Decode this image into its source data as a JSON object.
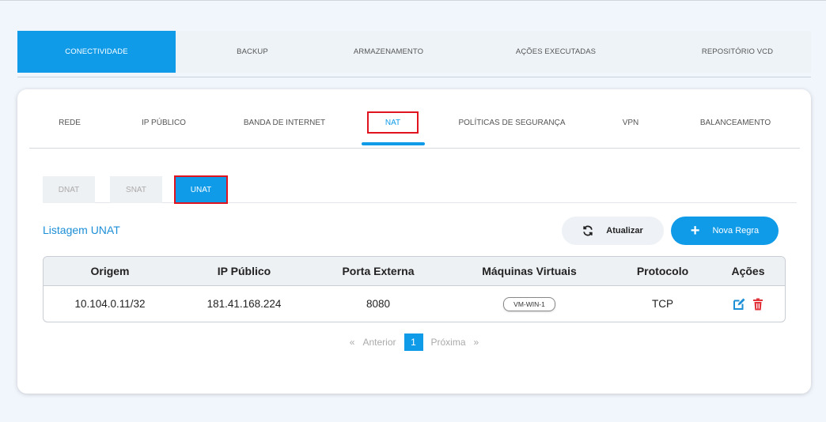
{
  "top_tabs": [
    {
      "label": "CONECTIVIDADE",
      "active": true
    },
    {
      "label": "BACKUP",
      "active": false
    },
    {
      "label": "ARMAZENAMENTO",
      "active": false
    },
    {
      "label": "AÇÕES EXECUTADAS",
      "active": false
    },
    {
      "label": "REPOSITÓRIO VCD",
      "active": false
    }
  ],
  "sub_tabs": [
    {
      "label": "REDE"
    },
    {
      "label": "IP PÚBLICO"
    },
    {
      "label": "BANDA DE INTERNET"
    },
    {
      "label": "NAT",
      "active": true
    },
    {
      "label": "POLÍTICAS DE SEGURANÇA"
    },
    {
      "label": "VPN"
    },
    {
      "label": "BALANCEAMENTO"
    }
  ],
  "nat_tabs": [
    {
      "label": "DNAT"
    },
    {
      "label": "SNAT"
    },
    {
      "label": "UNAT",
      "active": true
    }
  ],
  "list_title": "Listagem UNAT",
  "buttons": {
    "refresh": "Atualizar",
    "new_rule": "Nova Regra"
  },
  "table": {
    "headers": [
      "Origem",
      "IP Público",
      "Porta Externa",
      "Máquinas Virtuais",
      "Protocolo",
      "Ações"
    ],
    "rows": [
      {
        "origem": "10.104.0.11/32",
        "ip_publico": "181.41.168.224",
        "porta_externa": "8080",
        "vm": "VM-WIN-1",
        "protocolo": "TCP"
      }
    ]
  },
  "pagination": {
    "first": "«",
    "prev": "Anterior",
    "current": "1",
    "next": "Próxima",
    "last": "»"
  },
  "colors": {
    "accent": "#0f9be8",
    "highlight_border": "#e0141e",
    "edit_icon": "#1c8fd6",
    "delete_icon": "#e2333b"
  }
}
